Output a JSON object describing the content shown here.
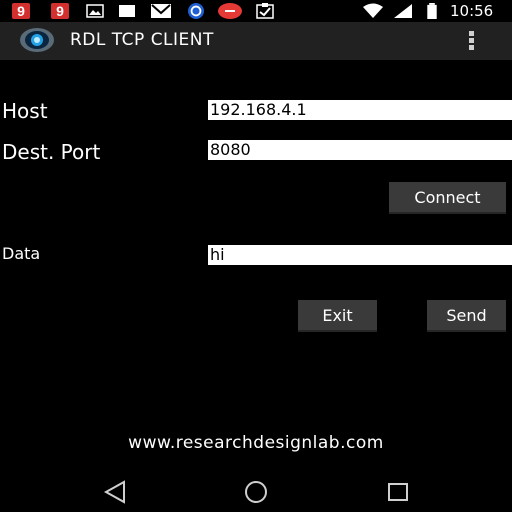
{
  "status_bar": {
    "notifications": [
      {
        "icon": "number-nine-notification-icon",
        "text": "9",
        "color": "#d32f2f"
      },
      {
        "icon": "number-nine-notification-icon",
        "text": "9",
        "color": "#d32f2f"
      },
      {
        "icon": "image-notification-icon"
      },
      {
        "icon": "square-notification-icon"
      },
      {
        "icon": "gmail-notification-icon"
      },
      {
        "icon": "sync-notification-icon",
        "color": "#1e5fd1"
      },
      {
        "icon": "record-notification-icon",
        "color": "#e53935"
      },
      {
        "icon": "clipboard-check-notification-icon"
      }
    ],
    "system": [
      "wifi-icon",
      "signal-icon",
      "battery-icon"
    ],
    "time": "10:56"
  },
  "action_bar": {
    "title": "RDL TCP CLIENT",
    "logo_icon": "rdl-logo-icon",
    "menu_icon": "overflow-menu-icon"
  },
  "form": {
    "host": {
      "label": "Host",
      "value": "192.168.4.1"
    },
    "port": {
      "label": "Dest. Port",
      "value": "8080"
    },
    "connect_label": "Connect",
    "data": {
      "label": "Data",
      "value": "hi"
    },
    "exit_label": "Exit",
    "send_label": "Send"
  },
  "footer": {
    "website": "www.researchdesignlab.com"
  },
  "nav_bar": {
    "buttons": [
      "back-icon",
      "home-icon",
      "recents-icon"
    ]
  },
  "colors": {
    "background": "#000000",
    "action_bar": "#212121",
    "button": "#3a3a3a",
    "input": "#ffffff",
    "notification_red": "#d32f2f"
  }
}
